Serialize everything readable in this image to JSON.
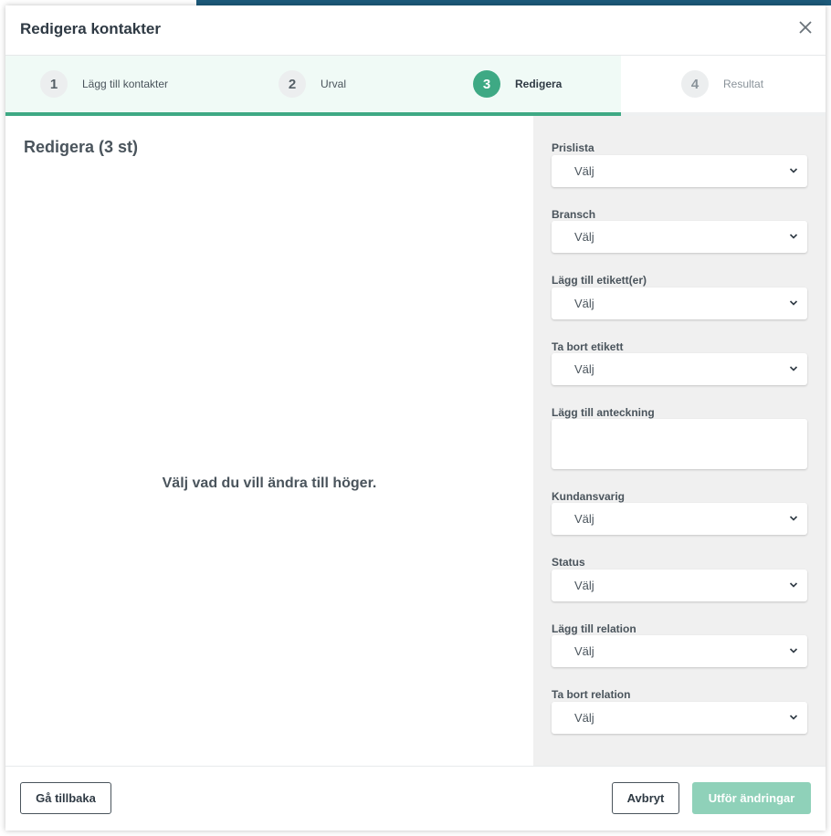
{
  "modal": {
    "title": "Redigera kontakter",
    "close_icon": "close-icon"
  },
  "steps": [
    {
      "number": "1",
      "label": "Lägg till kontakter",
      "state": "done"
    },
    {
      "number": "2",
      "label": "Urval",
      "state": "done"
    },
    {
      "number": "3",
      "label": "Redigera",
      "state": "active"
    },
    {
      "number": "4",
      "label": "Resultat",
      "state": "todo"
    }
  ],
  "left": {
    "title": "Redigera (3 st)",
    "empty_message": "Välj vad du vill ändra till höger."
  },
  "fields": {
    "prislista": {
      "label": "Prislista",
      "value": "Välj"
    },
    "bransch": {
      "label": "Bransch",
      "value": "Välj"
    },
    "add_tag": {
      "label": "Lägg till etikett(er)",
      "value": "Välj"
    },
    "remove_tag": {
      "label": "Ta bort etikett",
      "value": "Välj"
    },
    "note": {
      "label": "Lägg till anteckning",
      "value": ""
    },
    "account_manager": {
      "label": "Kundansvarig",
      "value": "Välj"
    },
    "status": {
      "label": "Status",
      "value": "Välj"
    },
    "add_relation": {
      "label": "Lägg till relation",
      "value": "Välj"
    },
    "remove_relation": {
      "label": "Ta bort relation",
      "value": "Välj"
    }
  },
  "footer": {
    "back_label": "Gå tillbaka",
    "cancel_label": "Avbryt",
    "apply_label": "Utför ändringar"
  },
  "colors": {
    "accent": "#3ea984",
    "accent_disabled": "#8fd1b9",
    "text": "#4a545c"
  }
}
